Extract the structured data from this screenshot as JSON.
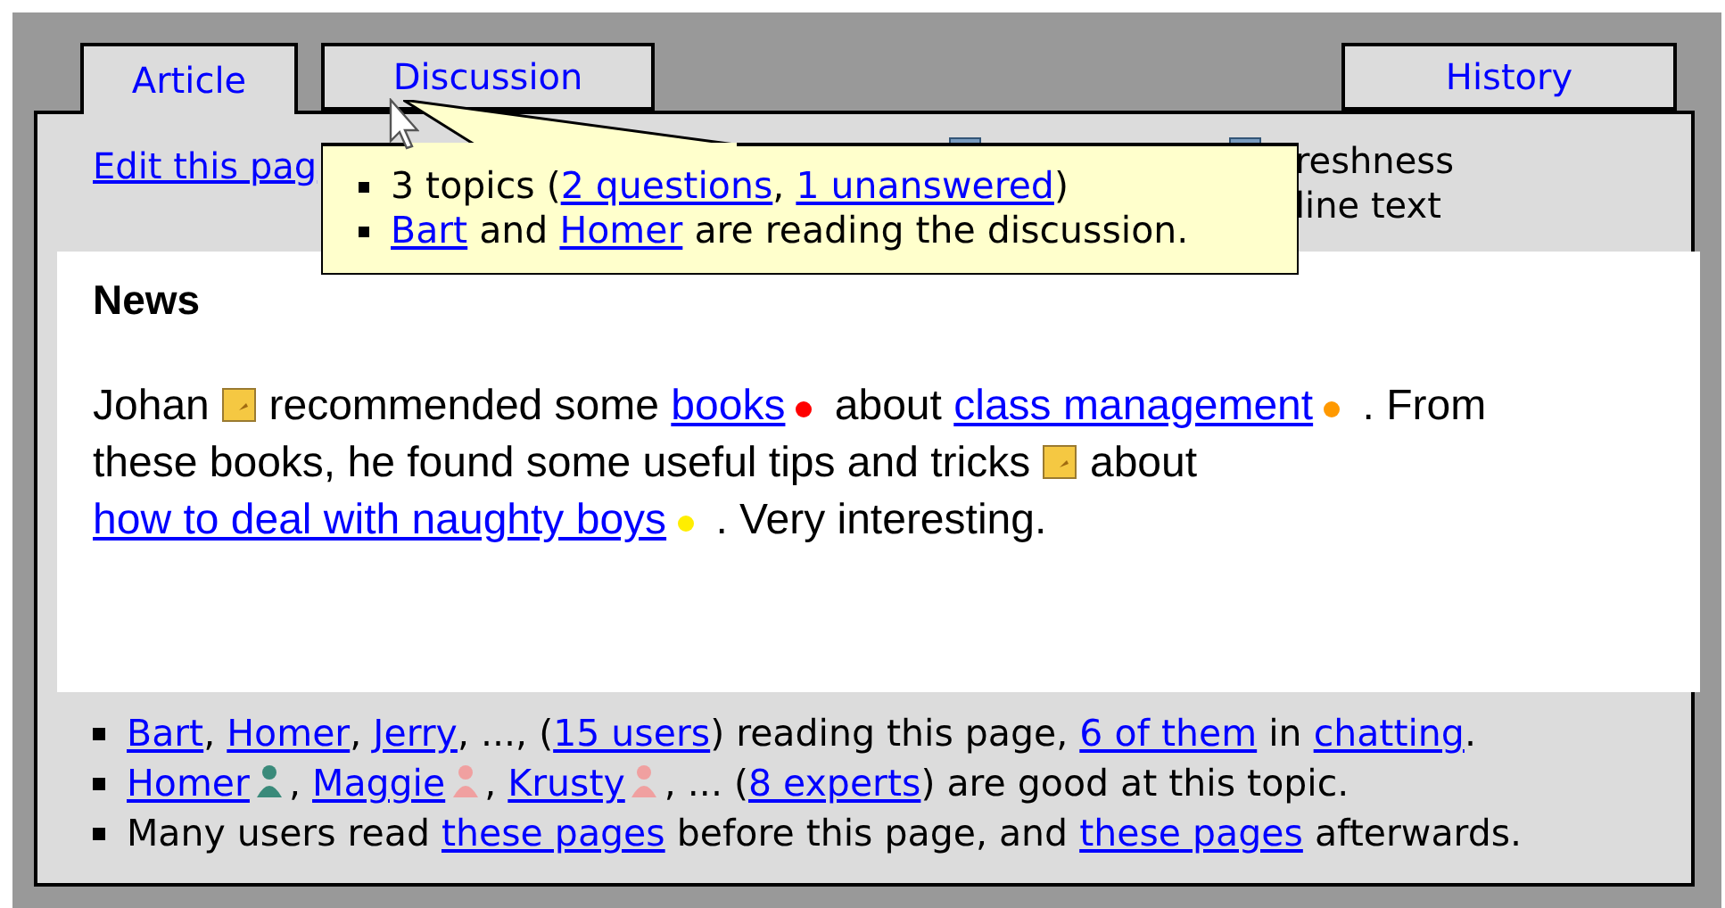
{
  "tabs": [
    {
      "label": "Article",
      "selected": true
    },
    {
      "label": "Discussion",
      "selected": false
    },
    {
      "label": "History",
      "selected": false
    }
  ],
  "toolbar": {
    "edit_link": "Edit this pag",
    "options": [
      "reshness",
      "line text"
    ]
  },
  "tooltip": {
    "lines": [
      [
        {
          "kind": "text",
          "text": "3 topics ("
        },
        {
          "kind": "link",
          "text": "2 questions",
          "after": ", "
        },
        {
          "kind": "link",
          "text": "1 unanswered"
        },
        {
          "kind": "text",
          "text": ")"
        }
      ],
      [
        {
          "kind": "link",
          "text": "Bart"
        },
        {
          "kind": "text",
          "text": " and "
        },
        {
          "kind": "link",
          "text": "Homer"
        },
        {
          "kind": "text",
          "text": " are reading the discussion."
        }
      ]
    ]
  },
  "news": {
    "title": "News",
    "body": [
      {
        "kind": "text",
        "text": "Johan "
      },
      {
        "kind": "note_icon"
      },
      {
        "kind": "text",
        "text": " recommended some "
      },
      {
        "kind": "link",
        "text": "books"
      },
      {
        "kind": "dot",
        "color": "#ff0000"
      },
      {
        "kind": "text",
        "text": " about "
      },
      {
        "kind": "link",
        "text": "class management"
      },
      {
        "kind": "dot",
        "color": "#ff9900"
      },
      {
        "kind": "text",
        "text": " . From these books, he found some useful tips and tricks "
      },
      {
        "kind": "note_icon"
      },
      {
        "kind": "text",
        "text": " about "
      },
      {
        "kind": "link",
        "text": "how to deal with naughty boys"
      },
      {
        "kind": "dot",
        "color": "#ffee00"
      },
      {
        "kind": "text",
        "text": " . Very interesting."
      }
    ]
  },
  "info": [
    [
      {
        "kind": "link",
        "text": "Bart",
        "after": ", "
      },
      {
        "kind": "link",
        "text": "Homer",
        "after": ", "
      },
      {
        "kind": "link",
        "text": "Jerry"
      },
      {
        "kind": "text",
        "text": ", ..., ("
      },
      {
        "kind": "link",
        "text": "15 users"
      },
      {
        "kind": "text",
        "text": ") reading this page, "
      },
      {
        "kind": "link",
        "text": "6 of them"
      },
      {
        "kind": "text",
        "text": " in "
      },
      {
        "kind": "link",
        "text": "chatting"
      },
      {
        "kind": "text",
        "text": "."
      }
    ],
    [
      {
        "kind": "link",
        "text": "Homer"
      },
      {
        "kind": "user_icon",
        "color": "#3a8a7a"
      },
      {
        "kind": "text",
        "text": ", "
      },
      {
        "kind": "link",
        "text": "Maggie"
      },
      {
        "kind": "user_icon",
        "color": "#f0a0a0"
      },
      {
        "kind": "text",
        "text": ", "
      },
      {
        "kind": "link",
        "text": "Krusty"
      },
      {
        "kind": "user_icon",
        "color": "#f0a0a0"
      },
      {
        "kind": "text",
        "text": ", ... ("
      },
      {
        "kind": "link",
        "text": "8 experts"
      },
      {
        "kind": "text",
        "text": ") are good at this topic."
      }
    ],
    [
      {
        "kind": "text",
        "text": "Many users read "
      },
      {
        "kind": "link",
        "text": "these pages"
      },
      {
        "kind": "text",
        "text": " before this page, and "
      },
      {
        "kind": "link",
        "text": "these pages"
      },
      {
        "kind": "text",
        "text": " afterwards."
      }
    ]
  ]
}
